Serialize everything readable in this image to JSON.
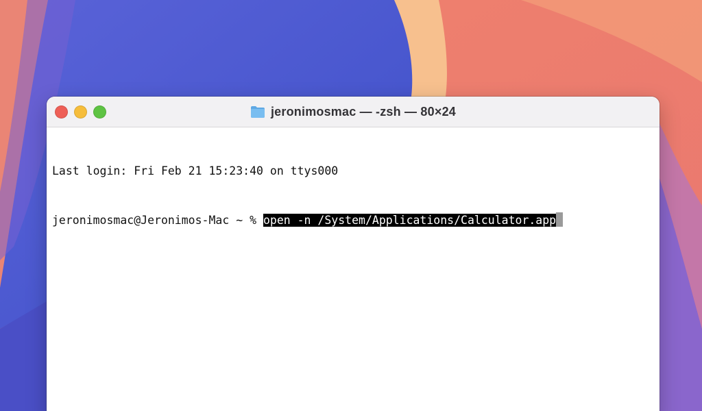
{
  "window": {
    "title": "jeronimosmac — -zsh — 80×24"
  },
  "terminal": {
    "last_login_line": "Last login: Fri Feb 21 15:23:40 on ttys000",
    "prompt": "jeronimosmac@Jeronimos-Mac ~ % ",
    "command": "open -n /System/Applications/Calculator.app"
  },
  "icons": {
    "title_icon": "folder-icon",
    "traffic_lights": [
      "close-button",
      "minimize-button",
      "zoom-button"
    ]
  },
  "colors": {
    "close": "#ee5f57",
    "minimize": "#f6bd3b",
    "zoom": "#5ec343",
    "folder": "#6fb3ea",
    "selection_bg": "#000000"
  }
}
